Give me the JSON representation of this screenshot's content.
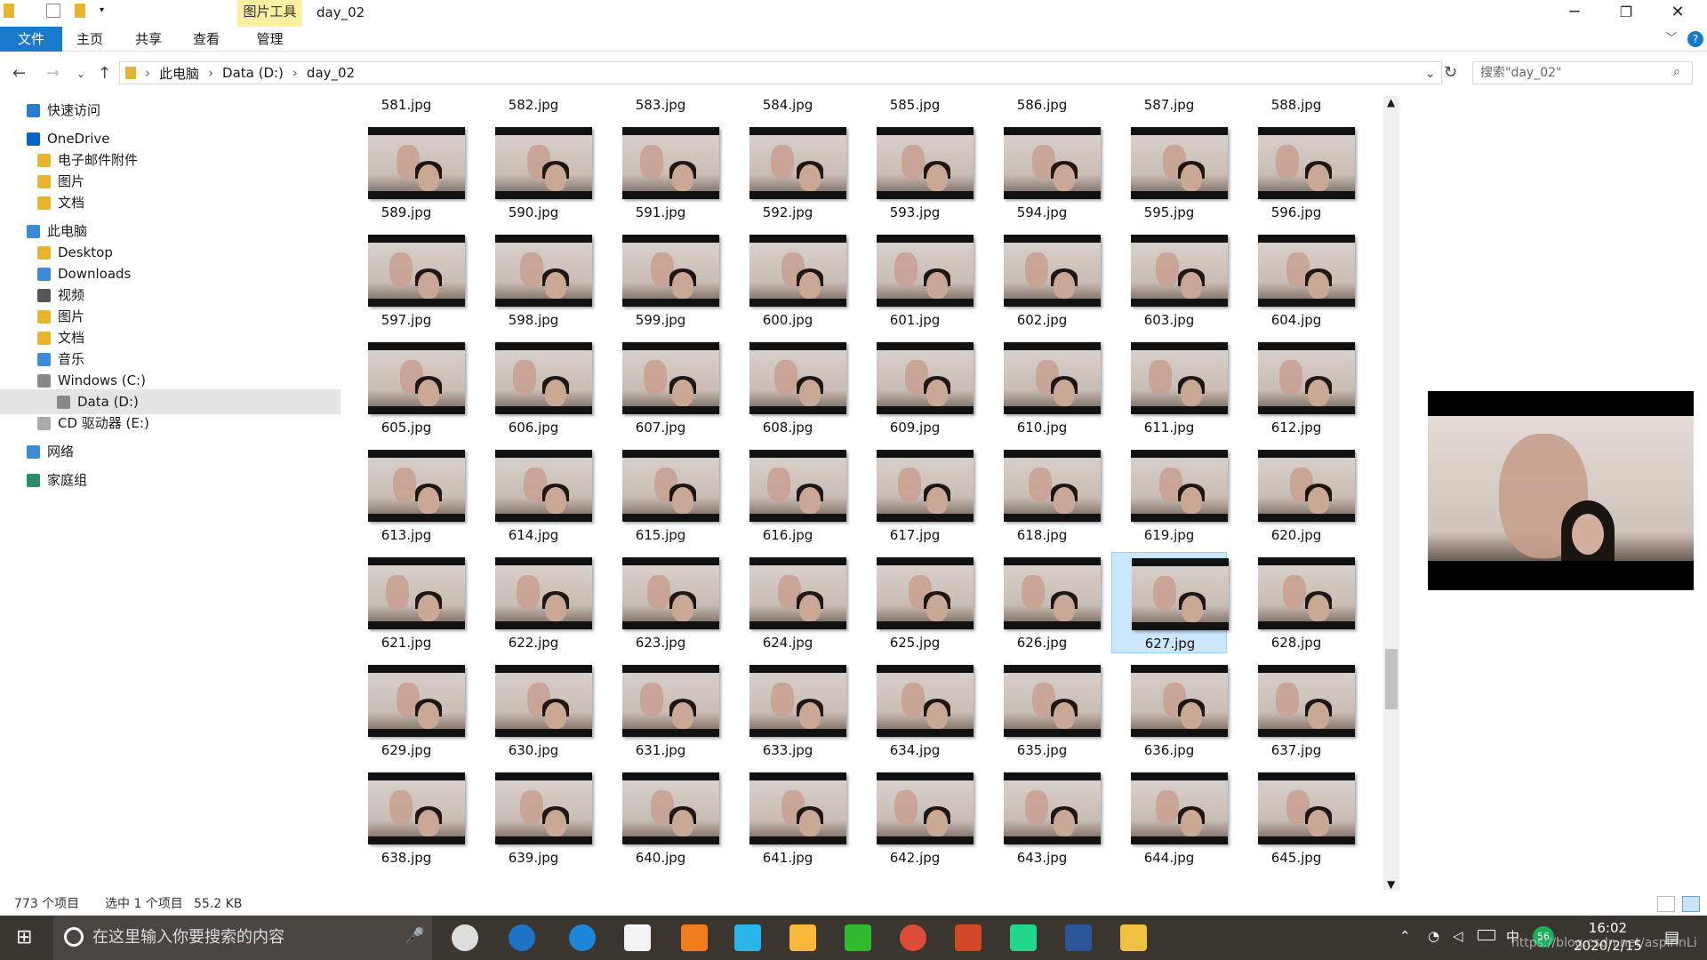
{
  "window": {
    "title": "day_02",
    "context_tab": "图片工具",
    "minimize": "─",
    "maximize": "❐",
    "close": "✕",
    "help": "?",
    "expand": "﹀"
  },
  "ribbon": {
    "tabs": [
      "文件",
      "主页",
      "共享",
      "查看",
      "管理"
    ]
  },
  "address": {
    "segments": [
      "此电脑",
      "Data (D:)",
      "day_02"
    ],
    "search_placeholder": "搜索\"day_02\""
  },
  "sidebar": {
    "items": [
      {
        "label": "快速访问",
        "level": 0,
        "icon": "star-icon"
      },
      {
        "label": "OneDrive",
        "level": 0,
        "icon": "cloud-icon"
      },
      {
        "label": "电子邮件附件",
        "level": 1,
        "icon": "folder-icon"
      },
      {
        "label": "图片",
        "level": 1,
        "icon": "folder-icon"
      },
      {
        "label": "文档",
        "level": 1,
        "icon": "folder-icon"
      },
      {
        "label": "此电脑",
        "level": 0,
        "icon": "computer-icon"
      },
      {
        "label": "Desktop",
        "level": 1,
        "icon": "folder-icon"
      },
      {
        "label": "Downloads",
        "level": 1,
        "icon": "download-folder-icon"
      },
      {
        "label": "视频",
        "level": 1,
        "icon": "video-folder-icon"
      },
      {
        "label": "图片",
        "level": 1,
        "icon": "picture-folder-icon"
      },
      {
        "label": "文档",
        "level": 1,
        "icon": "document-folder-icon"
      },
      {
        "label": "音乐",
        "level": 1,
        "icon": "music-folder-icon"
      },
      {
        "label": "Windows (C:)",
        "level": 1,
        "icon": "drive-icon"
      },
      {
        "label": "Data (D:)",
        "level": 1,
        "icon": "drive-icon",
        "selected": true
      },
      {
        "label": "CD 驱动器 (E:)",
        "level": 1,
        "icon": "cd-drive-icon"
      },
      {
        "label": "网络",
        "level": 0,
        "icon": "network-icon"
      },
      {
        "label": "家庭组",
        "level": 0,
        "icon": "homegroup-icon"
      }
    ]
  },
  "files": [
    "581.jpg",
    "582.jpg",
    "583.jpg",
    "584.jpg",
    "585.jpg",
    "586.jpg",
    "587.jpg",
    "588.jpg",
    "589.jpg",
    "590.jpg",
    "591.jpg",
    "592.jpg",
    "593.jpg",
    "594.jpg",
    "595.jpg",
    "596.jpg",
    "597.jpg",
    "598.jpg",
    "599.jpg",
    "600.jpg",
    "601.jpg",
    "602.jpg",
    "603.jpg",
    "604.jpg",
    "605.jpg",
    "606.jpg",
    "607.jpg",
    "608.jpg",
    "609.jpg",
    "610.jpg",
    "611.jpg",
    "612.jpg",
    "613.jpg",
    "614.jpg",
    "615.jpg",
    "616.jpg",
    "617.jpg",
    "618.jpg",
    "619.jpg",
    "620.jpg",
    "621.jpg",
    "622.jpg",
    "623.jpg",
    "624.jpg",
    "625.jpg",
    "626.jpg",
    "627.jpg",
    "628.jpg",
    "629.jpg",
    "630.jpg",
    "631.jpg",
    "633.jpg",
    "634.jpg",
    "635.jpg",
    "636.jpg",
    "637.jpg",
    "638.jpg",
    "639.jpg",
    "640.jpg",
    "641.jpg",
    "642.jpg",
    "643.jpg",
    "644.jpg",
    "645.jpg"
  ],
  "selected_file": "627.jpg",
  "status": {
    "count": "773 个项目",
    "selection": "选中 1 个项目",
    "size": "55.2 KB"
  },
  "taskbar": {
    "search_placeholder": "在这里输入你要搜索的内容",
    "time": "16:02",
    "date": "2020/2/15",
    "ime": "中",
    "badge": "56",
    "watermark": "https://blog.csdn.net/aspirinLi"
  }
}
